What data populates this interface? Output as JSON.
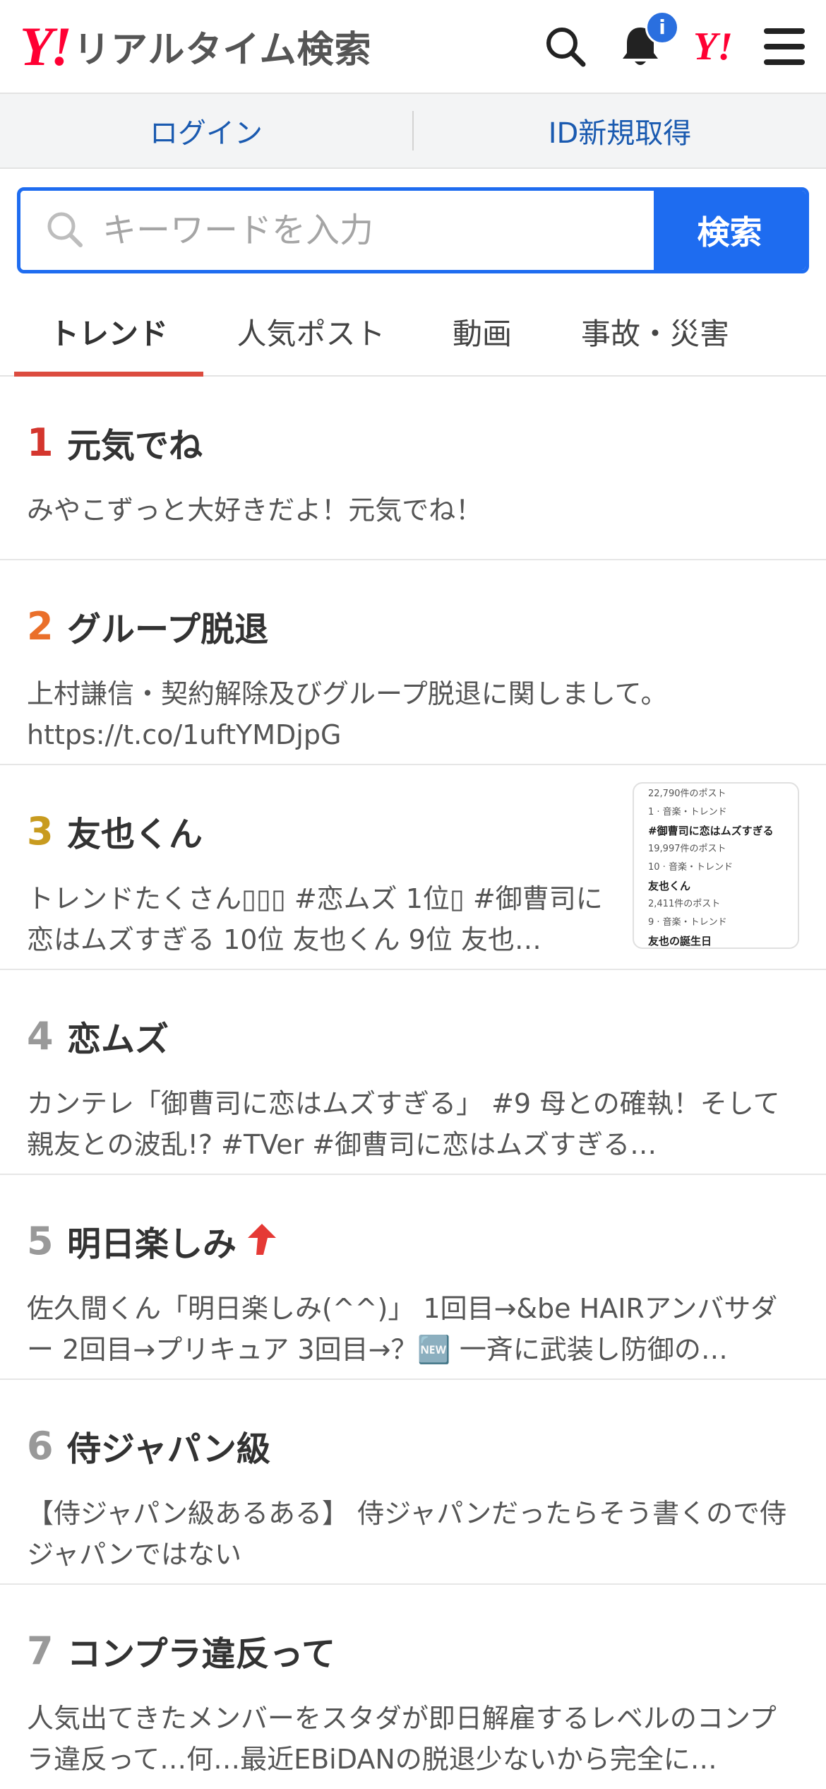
{
  "header": {
    "logo_mark": "Y!",
    "logo_text": "リアルタイム検索",
    "notification_badge": "i",
    "yahoo_mark": "Y!"
  },
  "loginbar": {
    "login": "ログイン",
    "register": "ID新規取得"
  },
  "search": {
    "placeholder": "キーワードを入力",
    "button": "検索"
  },
  "tabs": [
    {
      "label": "トレンド",
      "active": true
    },
    {
      "label": "人気ポスト"
    },
    {
      "label": "動画"
    },
    {
      "label": "事故・災害"
    }
  ],
  "trends": [
    {
      "rank": "1",
      "title": "元気でね",
      "desc": "みやこずっと大好きだよ！元気でね！"
    },
    {
      "rank": "2",
      "title": "グループ脱退",
      "desc": "上村謙信・契約解除及びグループ脱退に関しまして。 https://t.co/1uftYMDjpG"
    },
    {
      "rank": "3",
      "title": "友也くん",
      "desc": "トレンドたくさん▯▯▯ #恋ムズ 1位▯ #御曹司に恋はムズすぎる 10位 友也くん 9位 友也…"
    },
    {
      "rank": "4",
      "title": "恋ムズ",
      "desc": "カンテレ「御曹司に恋はムズすぎる」 #9 母との確執！そして親友との波乱!? #TVer #御曹司に恋はムズすぎる…"
    },
    {
      "rank": "5",
      "title": "明日楽しみ",
      "desc": "佐久間くん「明日楽しみ(^^)」 1回目→&be HAIRアンバサダー 2回目→プリキュア 3回目→？🆕 一斉に武装し防御の…"
    },
    {
      "rank": "6",
      "title": "侍ジャパン級",
      "desc": "【侍ジャパン級あるある】 侍ジャパンだったらそう書くので侍ジャパンではない"
    },
    {
      "rank": "7",
      "title": "コンプラ違反って",
      "desc": "人気出てきたメンバーをスタダが即日解雇するレベルのコンプラ違反って…何…最近EBiDANの脱退少ないから完全に…"
    }
  ],
  "thumb_lines": [
    "22,790件のポスト",
    "1 · 音楽・トレンド",
    "#御曹司に恋はムズすぎる",
    "19,997件のポスト",
    "10 · 音楽・トレンド",
    "友也くん",
    "2,411件のポスト",
    "9 · 音楽・トレンド",
    "友也の誕生日"
  ],
  "colors": {
    "accent": "#1e6cf0",
    "rank1": "#d4362e",
    "rank2": "#ea6f2a",
    "rank3": "#c89b1f",
    "tab_indicator": "#dc4c3f"
  }
}
